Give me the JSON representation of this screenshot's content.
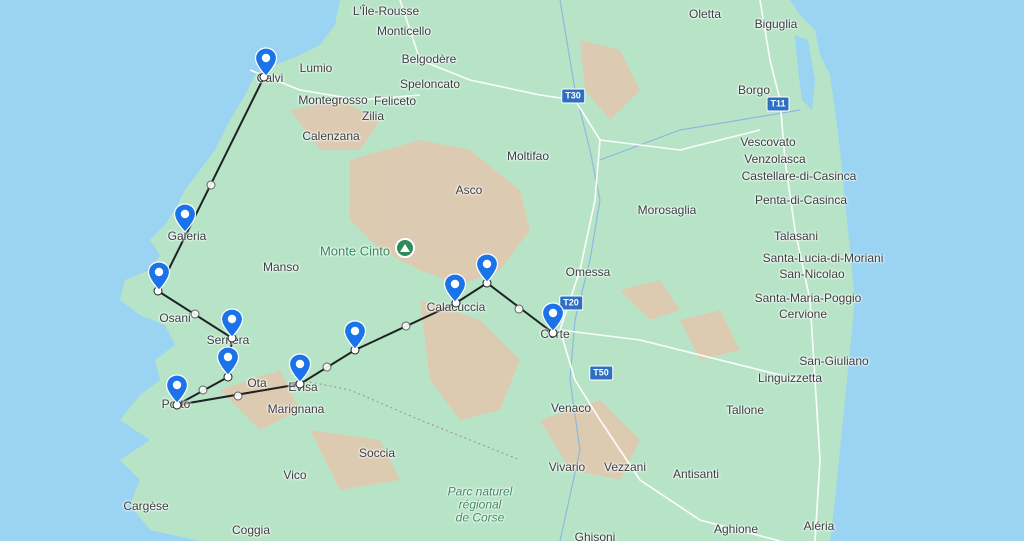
{
  "map": {
    "route_color": "#202124",
    "pin_color": "#1a73e8",
    "land_color": "#b7e4c7",
    "sea_color": "#9ad4f2",
    "mountain_color": "#e6c9b3",
    "places": [
      {
        "key": "ile-rousse",
        "label": "L'Île-Rousse"
      },
      {
        "key": "oletta",
        "label": "Oletta"
      },
      {
        "key": "biguglia",
        "label": "Biguglia"
      },
      {
        "key": "monticello",
        "label": "Monticello"
      },
      {
        "key": "lumio",
        "label": "Lumio"
      },
      {
        "key": "belgodere",
        "label": "Belgodère"
      },
      {
        "key": "speloncato",
        "label": "Speloncato"
      },
      {
        "key": "montegrosso",
        "label": "Montegrosso"
      },
      {
        "key": "feliceto",
        "label": "Feliceto"
      },
      {
        "key": "zilia",
        "label": "Zilia"
      },
      {
        "key": "borgo",
        "label": "Borgo"
      },
      {
        "key": "calenzana",
        "label": "Calenzana"
      },
      {
        "key": "vescovato",
        "label": "Vescovato"
      },
      {
        "key": "venzolasca",
        "label": "Venzolasca"
      },
      {
        "key": "moltifao",
        "label": "Moltifao"
      },
      {
        "key": "castellare",
        "label": "Castellare-di-Casinca"
      },
      {
        "key": "asco",
        "label": "Asco"
      },
      {
        "key": "penta",
        "label": "Penta-di-Casinca"
      },
      {
        "key": "morosaglia",
        "label": "Morosaglia"
      },
      {
        "key": "talasani",
        "label": "Talasani"
      },
      {
        "key": "manso",
        "label": "Manso"
      },
      {
        "key": "omessa",
        "label": "Omessa"
      },
      {
        "key": "santa-lucia",
        "label": "Santa-Lucia-di-Moriani"
      },
      {
        "key": "san-nicolao",
        "label": "San-Nicolao"
      },
      {
        "key": "santa-maria",
        "label": "Santa-Maria-Poggio"
      },
      {
        "key": "osani",
        "label": "Osani"
      },
      {
        "key": "cervione",
        "label": "Cervione"
      },
      {
        "key": "san-giuliano",
        "label": "San-Giuliano"
      },
      {
        "key": "linguizzetta",
        "label": "Linguizzetta"
      },
      {
        "key": "ota",
        "label": "Ota"
      },
      {
        "key": "marignana",
        "label": "Marignana"
      },
      {
        "key": "tallone",
        "label": "Tallone"
      },
      {
        "key": "venaco",
        "label": "Venaco"
      },
      {
        "key": "soccia",
        "label": "Soccia"
      },
      {
        "key": "vivario",
        "label": "Vivario"
      },
      {
        "key": "vezzani",
        "label": "Vezzani"
      },
      {
        "key": "vico",
        "label": "Vico"
      },
      {
        "key": "antisanti",
        "label": "Antisanti"
      },
      {
        "key": "cargese",
        "label": "Cargèse"
      },
      {
        "key": "coggia",
        "label": "Coggia"
      },
      {
        "key": "aghione",
        "label": "Aghione"
      },
      {
        "key": "aleria",
        "label": "Aléria"
      },
      {
        "key": "ghisoni",
        "label": "Ghisoni"
      }
    ],
    "stop_labels": [
      {
        "key": "calvi",
        "label": "Calvi"
      },
      {
        "key": "galeria",
        "label": "Galeria"
      },
      {
        "key": "serriera",
        "label": "Serriera"
      },
      {
        "key": "porto",
        "label": "Porto"
      },
      {
        "key": "evisa",
        "label": "Evisa"
      },
      {
        "key": "calacuccia",
        "label": "Calacuccia"
      },
      {
        "key": "corte",
        "label": "Corte"
      }
    ],
    "peak": {
      "label": "Monte Cinto",
      "icon": "mountain-peak-icon"
    },
    "park": {
      "label": "Parc naturel\nrégional\nde Corse"
    },
    "roads": [
      {
        "key": "t30",
        "label": "T30"
      },
      {
        "key": "t11",
        "label": "T11"
      },
      {
        "key": "t20",
        "label": "T20"
      },
      {
        "key": "t50",
        "label": "T50"
      }
    ],
    "route_stops": [
      "calvi",
      "galeria",
      "girolata",
      "serriera",
      "ota",
      "porto",
      "evisa",
      "col",
      "calacuccia",
      "pass",
      "corte"
    ]
  }
}
